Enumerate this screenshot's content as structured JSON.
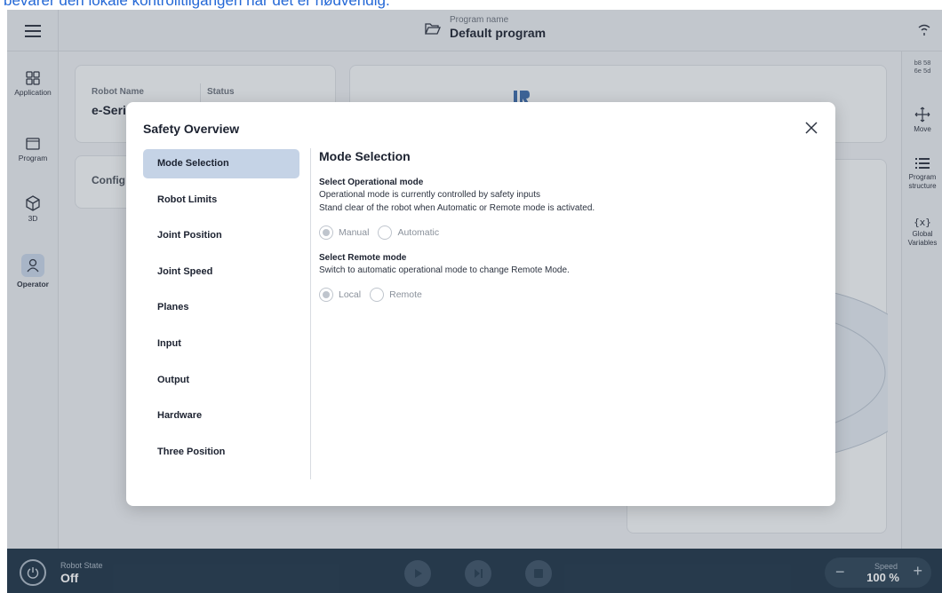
{
  "top_caption": "bevarer den lokale kontrolltilgangen når det er nødvendig.",
  "header": {
    "program_label_small": "Program name",
    "program_name": "Default program"
  },
  "left_nav": [
    {
      "label": "Application",
      "icon": "grid-icon"
    },
    {
      "label": "Program",
      "icon": "window-icon"
    },
    {
      "label": "3D",
      "icon": "cube-icon"
    },
    {
      "label": "Operator",
      "icon": "person-icon",
      "active": true
    }
  ],
  "right_nav": {
    "mac": "b8 58\n6e 5d",
    "items": [
      {
        "label": "Move",
        "icon": "move-icon"
      },
      {
        "label": "Program structure",
        "icon": "list-icon"
      },
      {
        "label": "Global Variables",
        "icon": "variable-icon"
      }
    ]
  },
  "bg": {
    "robot_name_label": "Robot Name",
    "status_label": "Status",
    "robot_name_value": "e-Seri",
    "config_label": "Config"
  },
  "modal": {
    "title": "Safety Overview",
    "menu": [
      "Mode Selection",
      "Robot Limits",
      "Joint Position",
      "Joint Speed",
      "Planes",
      "Input",
      "Output",
      "Hardware",
      "Three Position"
    ],
    "active_index": 0,
    "content": {
      "heading": "Mode Selection",
      "op_title": "Select Operational mode",
      "op_text1": "Operational mode is currently controlled by safety inputs",
      "op_text2": "Stand clear of the robot when Automatic or Remote mode is activated.",
      "op_options": [
        "Manual",
        "Automatic"
      ],
      "remote_title": "Select Remote mode",
      "remote_text": "Switch to automatic operational mode to change Remote Mode.",
      "remote_options": [
        "Local",
        "Remote"
      ]
    }
  },
  "bottom": {
    "robot_state_label": "Robot State",
    "robot_state_value": "Off",
    "speed_label": "Speed",
    "speed_value": "100 %"
  },
  "colors": {
    "accent": "#c5d3e6",
    "bottom_bar": "#1e3447",
    "caption": "#2468d6"
  }
}
